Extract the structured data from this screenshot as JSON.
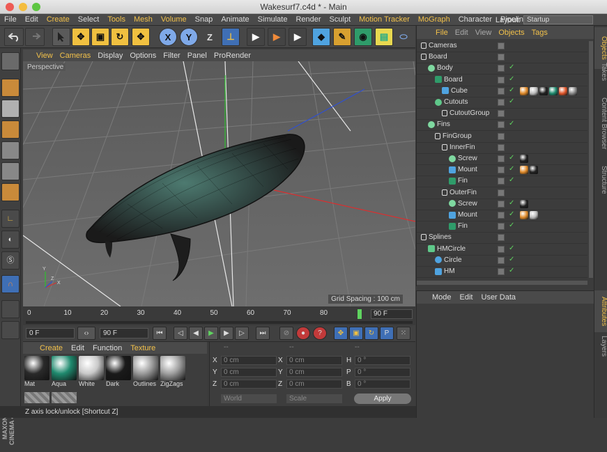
{
  "window": {
    "title": "Wakesurf7.c4d * - Main"
  },
  "menu": {
    "items": [
      "File",
      "Edit",
      "Create",
      "Select",
      "Tools",
      "Mesh",
      "Volume",
      "Snap",
      "Animate",
      "Simulate",
      "Render",
      "Sculpt",
      "Motion Tracker",
      "MoGraph",
      "Character",
      "Pipeline"
    ],
    "highlighted": [
      "Create",
      "Tools",
      "Mesh",
      "Volume",
      "Motion Tracker",
      "MoGraph"
    ],
    "layout_label": "Layout:",
    "layout_value": "Startup"
  },
  "toolbar": {
    "x_label": "X",
    "y_label": "Y",
    "z_label": "Z"
  },
  "viewport": {
    "menu": [
      "View",
      "Cameras",
      "Display",
      "Options",
      "Filter",
      "Panel",
      "ProRender"
    ],
    "highlighted": [
      "View",
      "Cameras"
    ],
    "label": "Perspective",
    "grid_spacing": "Grid Spacing : 100 cm"
  },
  "timeline": {
    "ticks": [
      "0",
      "10",
      "20",
      "30",
      "40",
      "50",
      "60",
      "70",
      "80"
    ],
    "end_frame": "90 F"
  },
  "transport": {
    "start_field": "0 F",
    "min_field": "0 F",
    "max_field": "90 F"
  },
  "materials": {
    "menu": [
      "Create",
      "Edit",
      "Function",
      "Texture"
    ],
    "highlighted": [
      "Create",
      "Texture"
    ],
    "items": [
      {
        "name": "Mat",
        "color": "#2a2a2a"
      },
      {
        "name": "Aqua",
        "color": "#1f8a6e"
      },
      {
        "name": "White",
        "color": "#c9c9c9"
      },
      {
        "name": "Dark",
        "color": "#1a1a1a"
      },
      {
        "name": "Outlines",
        "color": "#9a9a9a"
      },
      {
        "name": "ZigZags",
        "color": "#a0a0a0"
      }
    ]
  },
  "coords": {
    "header": [
      "--",
      "--",
      "--"
    ],
    "rows": [
      {
        "a_label": "X",
        "a_value": "0 cm",
        "b_label": "X",
        "b_value": "0 cm",
        "c_label": "H",
        "c_value": "0 °"
      },
      {
        "a_label": "Y",
        "a_value": "0 cm",
        "b_label": "Y",
        "b_value": "0 cm",
        "c_label": "P",
        "c_value": "0 °"
      },
      {
        "a_label": "Z",
        "a_value": "0 cm",
        "b_label": "Z",
        "b_value": "0 cm",
        "c_label": "B",
        "c_value": "0 °"
      }
    ],
    "world": "World",
    "scale": "Scale",
    "apply": "Apply"
  },
  "objects": {
    "menu": [
      "File",
      "Edit",
      "View",
      "Objects",
      "Tags"
    ],
    "highlighted": [
      "File",
      "Objects",
      "Tags"
    ],
    "rows": [
      {
        "name": "Cameras",
        "depth": 0,
        "icon": "null",
        "tick": ""
      },
      {
        "name": "Board",
        "depth": 0,
        "icon": "null",
        "tick": ""
      },
      {
        "name": "Body",
        "depth": 1,
        "icon": "sym",
        "tick": "✓"
      },
      {
        "name": "Board",
        "depth": 2,
        "icon": "sub",
        "tick": "✓"
      },
      {
        "name": "Cube",
        "depth": 3,
        "icon": "poly",
        "tick": "✓",
        "tags": [
          "#e08a2a",
          "#bbbbbb",
          "#222222",
          "#1f8a6e",
          "#e0562a",
          "#888888"
        ]
      },
      {
        "name": "Cutouts",
        "depth": 2,
        "icon": "bool",
        "tick": "✓"
      },
      {
        "name": "CutoutGroup",
        "depth": 3,
        "icon": "null",
        "tick": ""
      },
      {
        "name": "Fins",
        "depth": 1,
        "icon": "sym",
        "tick": "✓"
      },
      {
        "name": "FinGroup",
        "depth": 2,
        "icon": "null",
        "tick": ""
      },
      {
        "name": "InnerFin",
        "depth": 3,
        "icon": "null",
        "tick": ""
      },
      {
        "name": "Screw",
        "depth": 4,
        "icon": "sym",
        "tick": "✓",
        "tags": [
          "#222222"
        ]
      },
      {
        "name": "Mount",
        "depth": 4,
        "icon": "cube",
        "tick": "✓",
        "tags": [
          "#e08a2a",
          "#222222"
        ]
      },
      {
        "name": "Fin",
        "depth": 4,
        "icon": "sub",
        "tick": "✓"
      },
      {
        "name": "OuterFin",
        "depth": 3,
        "icon": "null",
        "tick": ""
      },
      {
        "name": "Screw",
        "depth": 4,
        "icon": "sym",
        "tick": "✓",
        "tags": [
          "#222222"
        ]
      },
      {
        "name": "Mount",
        "depth": 4,
        "icon": "cube",
        "tick": "✓",
        "tags": [
          "#e08a2a",
          "#bbbbbb"
        ]
      },
      {
        "name": "Fin",
        "depth": 4,
        "icon": "sub",
        "tick": "✓"
      },
      {
        "name": "Splines",
        "depth": 0,
        "icon": "null",
        "tick": ""
      },
      {
        "name": "HMCircle",
        "depth": 1,
        "icon": "sweep",
        "tick": "✓"
      },
      {
        "name": "Circle",
        "depth": 2,
        "icon": "circle",
        "tick": "✓"
      },
      {
        "name": "HM",
        "depth": 2,
        "icon": "spline",
        "tick": "✓"
      }
    ]
  },
  "attributes": {
    "menu": [
      "Mode",
      "Edit",
      "User Data"
    ]
  },
  "right_tabs": [
    "Objects",
    "Takes",
    "Content Browser",
    "Structure",
    "Attributes",
    "Layers"
  ],
  "status": "Z axis lock/unlock [Shortcut Z]",
  "brand": "MAXON CINEMA 4D"
}
